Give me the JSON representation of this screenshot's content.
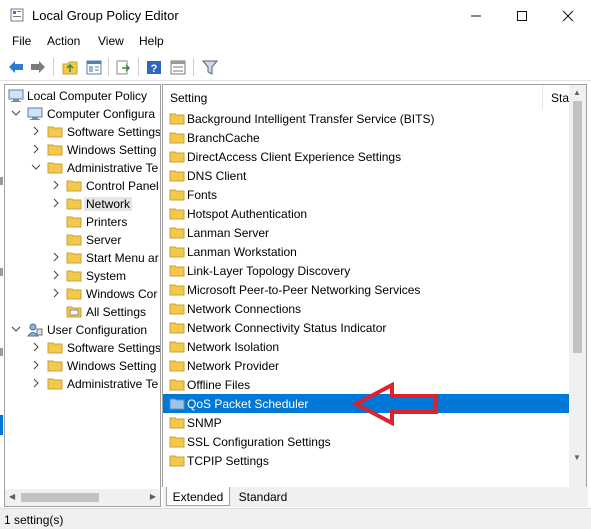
{
  "window": {
    "title": "Local Group Policy Editor"
  },
  "menu": [
    "File",
    "Action",
    "View",
    "Help"
  ],
  "toolbar": [
    "back-icon",
    "forward-icon",
    "up-folder-icon",
    "show-hide-tree-icon",
    "export-list-icon",
    "help-icon",
    "properties-icon",
    "filter-icon"
  ],
  "tree": [
    {
      "label": "Local Computer Policy"
    },
    {
      "label": "Computer Configura"
    },
    {
      "label": "Software Settings"
    },
    {
      "label": "Windows Setting"
    },
    {
      "label": "Administrative Te"
    },
    {
      "label": "Control Panel"
    },
    {
      "label": "Network"
    },
    {
      "label": "Printers"
    },
    {
      "label": "Server"
    },
    {
      "label": "Start Menu ar"
    },
    {
      "label": "System"
    },
    {
      "label": "Windows Cor"
    },
    {
      "label": "All Settings"
    },
    {
      "label": "User Configuration"
    },
    {
      "label": "Software Settings"
    },
    {
      "label": "Windows Setting"
    },
    {
      "label": "Administrative Te"
    }
  ],
  "list": {
    "col_setting": "Setting",
    "col_state": "Stat",
    "items": [
      "Background Intelligent Transfer Service (BITS)",
      "BranchCache",
      "DirectAccess Client Experience Settings",
      "DNS Client",
      "Fonts",
      "Hotspot Authentication",
      "Lanman Server",
      "Lanman Workstation",
      "Link-Layer Topology Discovery",
      "Microsoft Peer-to-Peer Networking Services",
      "Network Connections",
      "Network Connectivity Status Indicator",
      "Network Isolation",
      "Network Provider",
      "Offline Files",
      "QoS Packet Scheduler",
      "SNMP",
      "SSL Configuration Settings",
      "TCPIP Settings"
    ],
    "selected": "QoS Packet Scheduler"
  },
  "tabs": {
    "extended": "Extended",
    "standard": "Standard"
  },
  "status": "1 setting(s)",
  "colors": {
    "selection": "#0078d7",
    "folder": "#f3c84b",
    "arrow": "#d9232d"
  }
}
